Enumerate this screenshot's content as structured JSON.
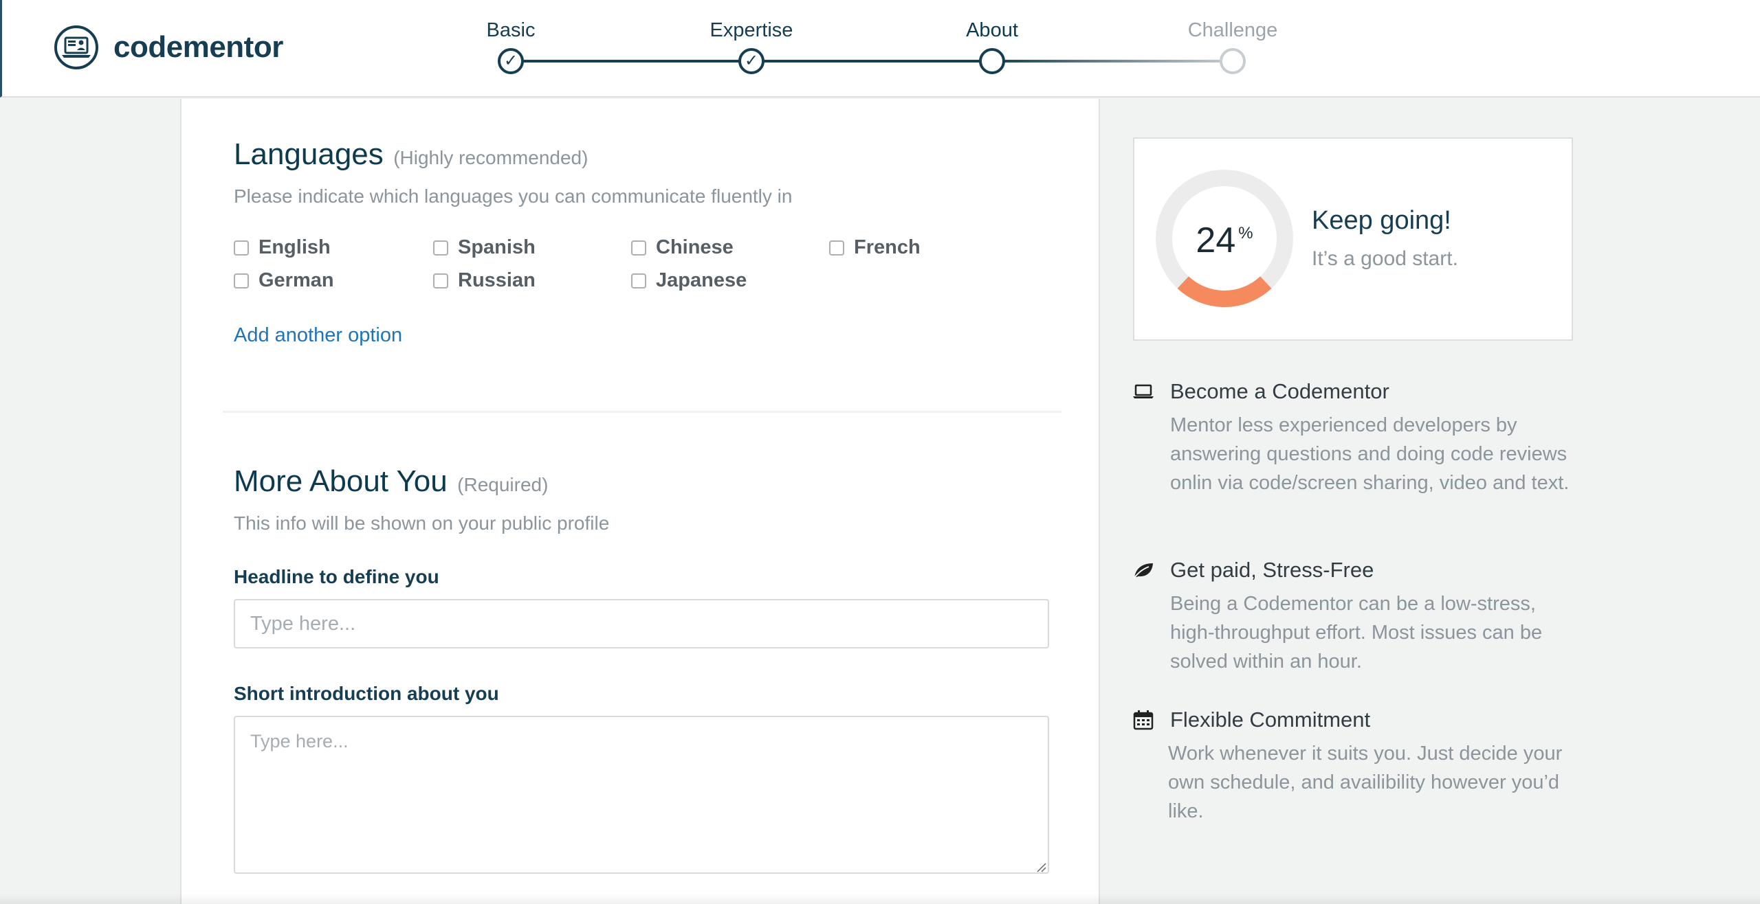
{
  "brand": {
    "name": "codementor"
  },
  "colors": {
    "primary": "#163d52",
    "link": "#1f74b8",
    "progress": "#f58a5f",
    "muted": "#8b959b"
  },
  "steps": [
    {
      "label": "Basic",
      "state": "done",
      "mark": "✓"
    },
    {
      "label": "Expertise",
      "state": "done",
      "mark": "✓"
    },
    {
      "label": "About",
      "state": "current",
      "mark": ""
    },
    {
      "label": "Challenge",
      "state": "todo",
      "mark": ""
    }
  ],
  "languages": {
    "title": "Languages",
    "note": "(Highly recommended)",
    "subtitle": "Please indicate which languages you can communicate fluently in",
    "options": [
      {
        "label": "English",
        "checked": false
      },
      {
        "label": "Spanish",
        "checked": false
      },
      {
        "label": "Chinese",
        "checked": false
      },
      {
        "label": "French",
        "checked": false
      },
      {
        "label": "German",
        "checked": false
      },
      {
        "label": "Russian",
        "checked": false
      },
      {
        "label": "Japanese",
        "checked": false
      }
    ],
    "add_option": "Add another option"
  },
  "about": {
    "title": "More About You",
    "note": "(Required)",
    "subtitle": "This info will be shown on your public profile",
    "headline_label": "Headline to define you",
    "headline_placeholder": "Type here...",
    "headline_value": "",
    "intro_label": "Short introduction about you",
    "intro_placeholder": "Type here...",
    "intro_value": ""
  },
  "progress": {
    "percent": 24,
    "percent_text": "24",
    "percent_symbol": "%",
    "title": "Keep going!",
    "subtitle": "It’s a good start."
  },
  "benefits": [
    {
      "icon": "laptop-icon",
      "title": "Become a Codementor",
      "text": "Mentor less experienced developers by answering questions and doing code reviews onlin via code/screen sharing, video and text."
    },
    {
      "icon": "leaf-icon",
      "title": "Get paid, Stress-Free",
      "text": "Being a Codementor can be a low-stress, high-throughput effort. Most issues can be solved within an hour."
    },
    {
      "icon": "calendar-icon",
      "title": "Flexible Commitment",
      "text": "Work whenever it suits you. Just decide your own schedule, and availibility however you’d like."
    }
  ]
}
